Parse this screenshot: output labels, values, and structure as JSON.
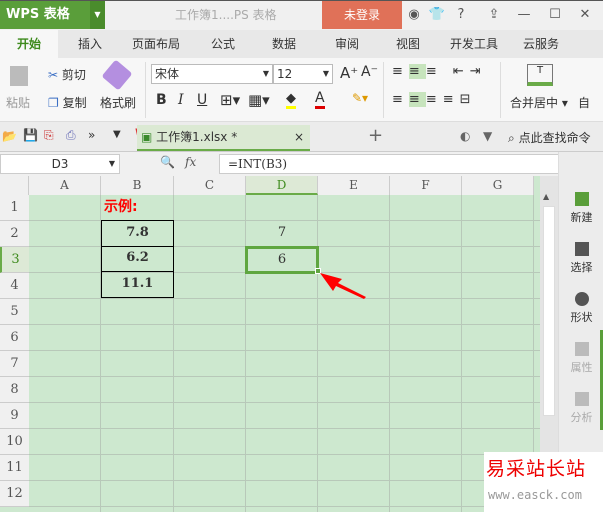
{
  "titlebar": {
    "app": "WPS 表格",
    "doc_title": "工作簿1....PS 表格",
    "login": "未登录",
    "help": "?"
  },
  "menu": [
    "开始",
    "插入",
    "页面布局",
    "公式",
    "数据",
    "审阅",
    "视图",
    "开发工具",
    "云服务"
  ],
  "ribbon": {
    "paste": "粘贴",
    "cut": "剪切",
    "copy": "复制",
    "format_painter": "格式刷",
    "font": "宋体",
    "size": "12",
    "bold": "B",
    "italic": "I",
    "underline": "U",
    "merge": "合并居中",
    "auto": "自"
  },
  "tabs": {
    "doc": "工作簿1.xlsx *",
    "search": "点此查找命令"
  },
  "formula_bar": {
    "name_box": "D3",
    "fx": "fx",
    "formula": "=INT(B3)"
  },
  "sheet": {
    "columns": [
      "A",
      "B",
      "C",
      "D",
      "E",
      "F",
      "G"
    ],
    "rows": [
      "1",
      "2",
      "3",
      "4",
      "5",
      "6",
      "7",
      "8",
      "9",
      "10",
      "11",
      "12"
    ],
    "label": "示例:",
    "b_values": [
      "7.8",
      "6.2",
      "11.1"
    ],
    "d2": "7",
    "d3": "6"
  },
  "side": [
    "新建",
    "选择",
    "形状",
    "属性",
    "分析"
  ],
  "watermark": {
    "name": "易采站长站",
    "url": "www.easck.com"
  },
  "colors": {
    "accent": "#5a9e3a",
    "grid": "#cde8cf",
    "login": "#e07158",
    "label": "#ff0000"
  }
}
